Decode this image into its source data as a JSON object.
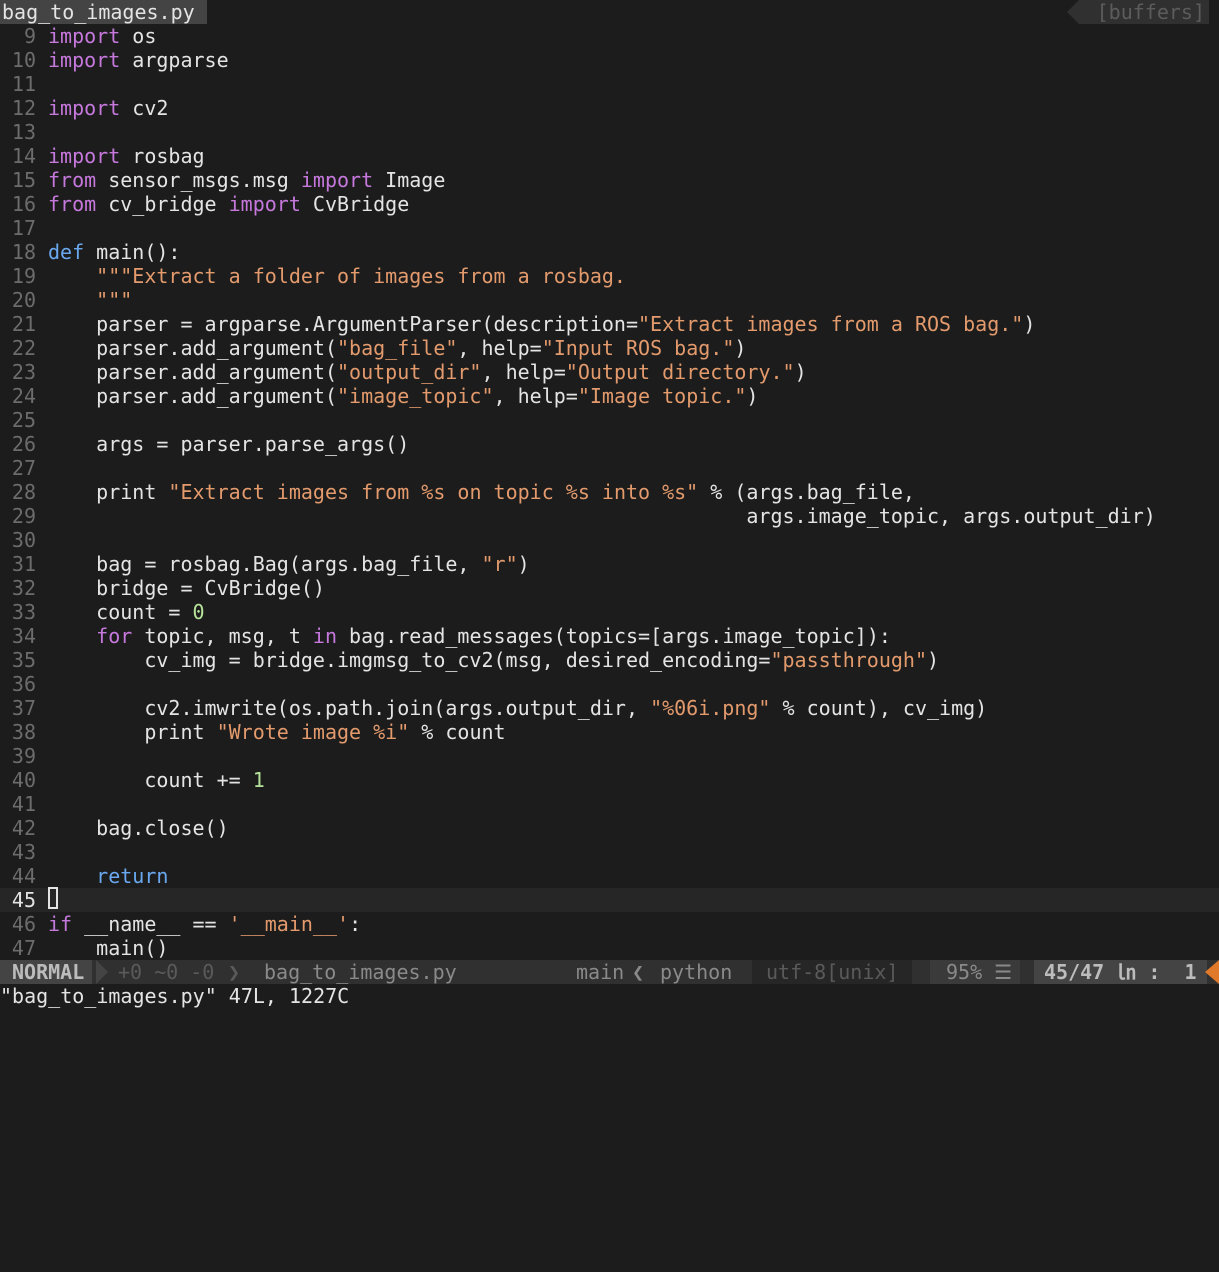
{
  "tabline": {
    "active_buffer": "bag_to_images.py",
    "right_label": "[buffers]"
  },
  "lines": [
    {
      "n": "9",
      "tokens": [
        [
          "kw",
          "import"
        ],
        [
          "code",
          " os"
        ]
      ]
    },
    {
      "n": "10",
      "tokens": [
        [
          "kw",
          "import"
        ],
        [
          "code",
          " argparse"
        ]
      ]
    },
    {
      "n": "11",
      "tokens": []
    },
    {
      "n": "12",
      "tokens": [
        [
          "kw",
          "import"
        ],
        [
          "code",
          " cv2"
        ]
      ]
    },
    {
      "n": "13",
      "tokens": []
    },
    {
      "n": "14",
      "tokens": [
        [
          "kw",
          "import"
        ],
        [
          "code",
          " rosbag"
        ]
      ]
    },
    {
      "n": "15",
      "tokens": [
        [
          "kw",
          "from"
        ],
        [
          "code",
          " sensor_msgs.msg "
        ],
        [
          "kw",
          "import"
        ],
        [
          "code",
          " Image"
        ]
      ]
    },
    {
      "n": "16",
      "tokens": [
        [
          "kw",
          "from"
        ],
        [
          "code",
          " cv_bridge "
        ],
        [
          "kw",
          "import"
        ],
        [
          "code",
          " CvBridge"
        ]
      ]
    },
    {
      "n": "17",
      "tokens": []
    },
    {
      "n": "18",
      "tokens": [
        [
          "kw2",
          "def"
        ],
        [
          "code",
          " main():"
        ]
      ]
    },
    {
      "n": "19",
      "tokens": [
        [
          "code",
          "    "
        ],
        [
          "str",
          "\"\"\"Extract a folder of images from a rosbag."
        ]
      ]
    },
    {
      "n": "20",
      "tokens": [
        [
          "code",
          "    "
        ],
        [
          "str",
          "\"\"\""
        ]
      ]
    },
    {
      "n": "21",
      "tokens": [
        [
          "code",
          "    parser = argparse.ArgumentParser(description="
        ],
        [
          "str",
          "\"Extract images from a ROS bag.\""
        ],
        [
          "code",
          ")"
        ]
      ]
    },
    {
      "n": "22",
      "tokens": [
        [
          "code",
          "    parser.add_argument("
        ],
        [
          "str",
          "\"bag_file\""
        ],
        [
          "code",
          ", help="
        ],
        [
          "str",
          "\"Input ROS bag.\""
        ],
        [
          "code",
          ")"
        ]
      ]
    },
    {
      "n": "23",
      "tokens": [
        [
          "code",
          "    parser.add_argument("
        ],
        [
          "str",
          "\"output_dir\""
        ],
        [
          "code",
          ", help="
        ],
        [
          "str",
          "\"Output directory.\""
        ],
        [
          "code",
          ")"
        ]
      ]
    },
    {
      "n": "24",
      "tokens": [
        [
          "code",
          "    parser.add_argument("
        ],
        [
          "str",
          "\"image_topic\""
        ],
        [
          "code",
          ", help="
        ],
        [
          "str",
          "\"Image topic.\""
        ],
        [
          "code",
          ")"
        ]
      ]
    },
    {
      "n": "25",
      "tokens": []
    },
    {
      "n": "26",
      "tokens": [
        [
          "code",
          "    args = parser.parse_args()"
        ]
      ]
    },
    {
      "n": "27",
      "tokens": []
    },
    {
      "n": "28",
      "tokens": [
        [
          "code",
          "    print "
        ],
        [
          "str",
          "\"Extract images from %s on topic %s into %s\""
        ],
        [
          "code",
          " % (args.bag_file,"
        ]
      ]
    },
    {
      "n": "29",
      "tokens": [
        [
          "code",
          "                                                          args.image_topic, args.output_dir)"
        ]
      ]
    },
    {
      "n": "30",
      "tokens": []
    },
    {
      "n": "31",
      "tokens": [
        [
          "code",
          "    bag = rosbag.Bag(args.bag_file, "
        ],
        [
          "str",
          "\"r\""
        ],
        [
          "code",
          ")"
        ]
      ]
    },
    {
      "n": "32",
      "tokens": [
        [
          "code",
          "    bridge = CvBridge()"
        ]
      ]
    },
    {
      "n": "33",
      "tokens": [
        [
          "code",
          "    count = "
        ],
        [
          "num",
          "0"
        ]
      ]
    },
    {
      "n": "34",
      "tokens": [
        [
          "code",
          "    "
        ],
        [
          "kw",
          "for"
        ],
        [
          "code",
          " topic, msg, t "
        ],
        [
          "kw",
          "in"
        ],
        [
          "code",
          " bag.read_messages(topics=[args.image_topic]):"
        ]
      ]
    },
    {
      "n": "35",
      "tokens": [
        [
          "code",
          "        cv_img = bridge.imgmsg_to_cv2(msg, desired_encoding="
        ],
        [
          "str",
          "\"passthrough\""
        ],
        [
          "code",
          ")"
        ]
      ]
    },
    {
      "n": "36",
      "tokens": []
    },
    {
      "n": "37",
      "tokens": [
        [
          "code",
          "        cv2.imwrite(os.path.join(args.output_dir, "
        ],
        [
          "str",
          "\"%06i.png\""
        ],
        [
          "code",
          " % count), cv_img)"
        ]
      ]
    },
    {
      "n": "38",
      "tokens": [
        [
          "code",
          "        print "
        ],
        [
          "str",
          "\"Wrote image %i\""
        ],
        [
          "code",
          " % count"
        ]
      ]
    },
    {
      "n": "39",
      "tokens": []
    },
    {
      "n": "40",
      "tokens": [
        [
          "code",
          "        count += "
        ],
        [
          "num",
          "1"
        ]
      ]
    },
    {
      "n": "41",
      "tokens": []
    },
    {
      "n": "42",
      "tokens": [
        [
          "code",
          "    bag.close()"
        ]
      ]
    },
    {
      "n": "43",
      "tokens": []
    },
    {
      "n": "44",
      "tokens": [
        [
          "code",
          "    "
        ],
        [
          "kw2",
          "return"
        ]
      ]
    },
    {
      "n": "45",
      "tokens": [],
      "current": true
    },
    {
      "n": "46",
      "tokens": [
        [
          "kw",
          "if"
        ],
        [
          "code",
          " __name__ == "
        ],
        [
          "str",
          "'__main__'"
        ],
        [
          "code",
          ":"
        ]
      ]
    },
    {
      "n": "47",
      "tokens": [
        [
          "code",
          "    main()"
        ]
      ]
    }
  ],
  "statusline": {
    "mode": "NORMAL",
    "hunks": "+0 ~0 -0",
    "filename": "bag_to_images.py",
    "branch": "main",
    "filetype": "python",
    "encoding": "utf-8[unix]",
    "percent": "95%",
    "percent_icon": "☰",
    "position": "45/47",
    "column_icon": "㏑",
    "column_sep": ":",
    "column": "1"
  },
  "cmdline": "\"bag_to_images.py\" 47L, 1227C"
}
